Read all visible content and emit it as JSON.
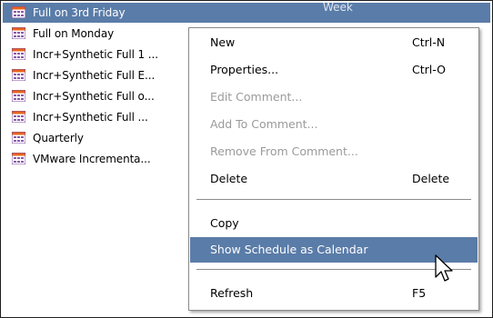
{
  "list": {
    "column_header_partial": "Week",
    "items": [
      {
        "label": "Full on 3rd Friday",
        "selected": true
      },
      {
        "label": "Full on Monday",
        "selected": false
      },
      {
        "label": "Incr+Synthetic Full 1 ...",
        "selected": false
      },
      {
        "label": "Incr+Synthetic Full E...",
        "selected": false
      },
      {
        "label": "Incr+Synthetic Full o...",
        "selected": false
      },
      {
        "label": "Incr+Synthetic Full ...",
        "selected": false
      },
      {
        "label": "Quarterly",
        "selected": false
      },
      {
        "label": "VMware Incrementa...",
        "selected": false
      }
    ],
    "item_icon": "calendar-grid-icon"
  },
  "context_menu": {
    "items": [
      {
        "label": "New",
        "shortcut": "Ctrl-N",
        "enabled": true
      },
      {
        "label": "Properties...",
        "shortcut": "Ctrl-O",
        "enabled": true
      },
      {
        "label": "Edit Comment...",
        "shortcut": "",
        "enabled": false
      },
      {
        "label": "Add To Comment...",
        "shortcut": "",
        "enabled": false
      },
      {
        "label": "Remove From Comment...",
        "shortcut": "",
        "enabled": false
      },
      {
        "label": "Delete",
        "shortcut": "Delete",
        "enabled": true
      },
      {
        "label": "Copy",
        "shortcut": "",
        "enabled": true
      },
      {
        "label": "Show Schedule as Calendar",
        "shortcut": "",
        "enabled": true,
        "highlighted": true
      },
      {
        "label": "Refresh",
        "shortcut": "F5",
        "enabled": true
      }
    ]
  },
  "colors": {
    "selection": "#5a7ca8",
    "disabled_text": "#9a9a9a",
    "icon_orange": "#e8641e",
    "icon_purple": "#8a5aa8"
  }
}
